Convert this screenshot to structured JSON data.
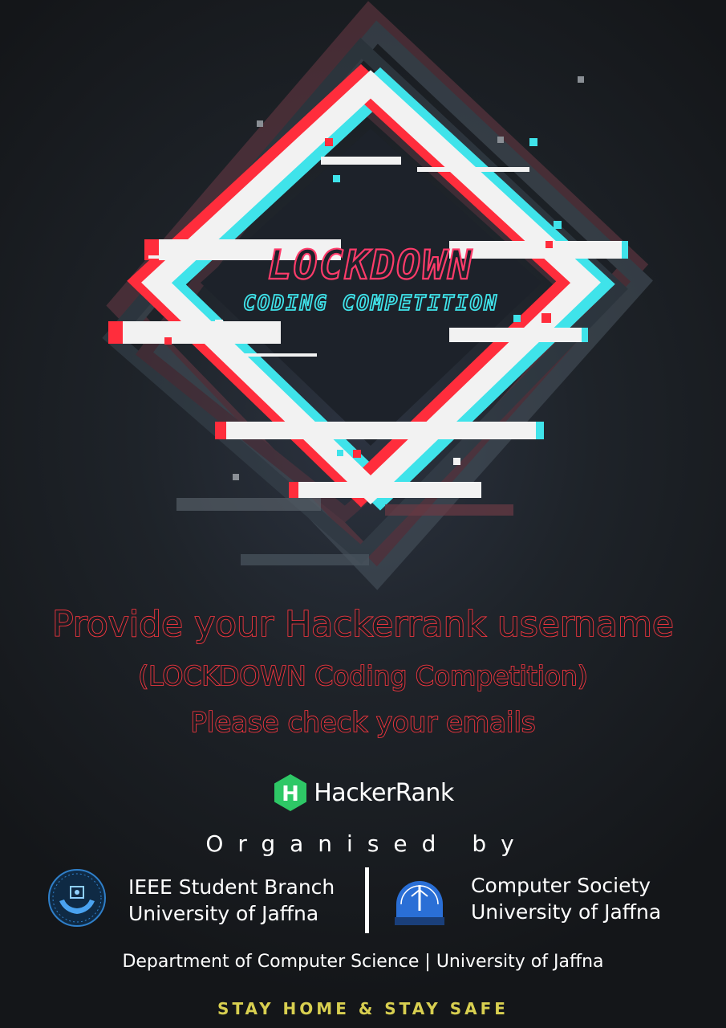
{
  "poster": {
    "logo_title": "LOCKDOWN",
    "logo_subtitle": "CODING COMPETITION",
    "headline": "Provide your Hackerrank username",
    "subheadline": "(LOCKDOWN Coding Competition)",
    "notice": "Please check your emails",
    "platform_name": "HackerRank",
    "organised_by": "Organised by",
    "organizers": [
      {
        "line1": "IEEE Student Branch",
        "line2": "University of Jaffna",
        "logo": "ieee-hands-icon"
      },
      {
        "line1": "Computer Society",
        "line2": "University of Jaffna",
        "logo": "computer-society-seal-icon"
      }
    ],
    "department": "Department of Computer Science | University of Jaffna",
    "tagline": "STAY HOME & STAY SAFE"
  },
  "colors": {
    "accent_red": "#ff3b45",
    "accent_cyan": "#3fe3ea",
    "hackerrank_green": "#2ec866",
    "tagline_yellow": "#d8cf50",
    "background": "#1e2329"
  }
}
